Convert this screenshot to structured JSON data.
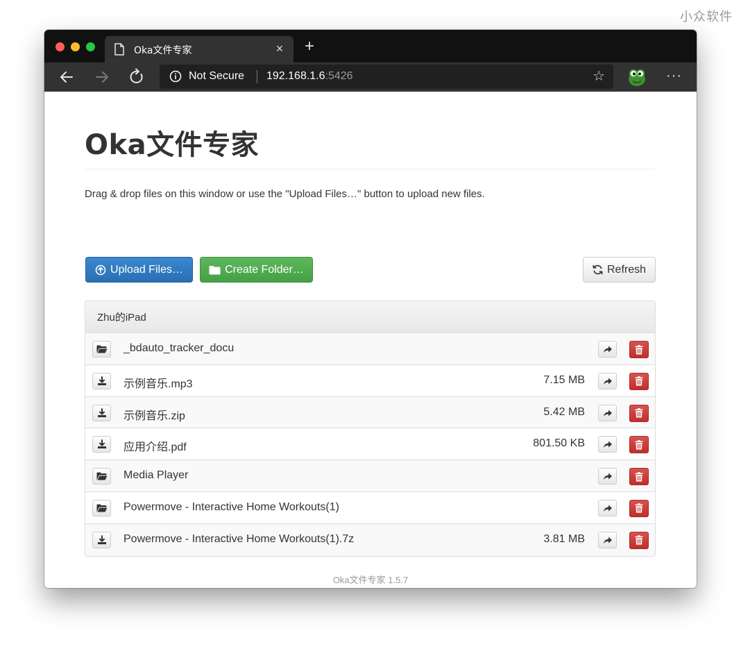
{
  "watermark": "小众软件",
  "browser": {
    "tab_title": "Oka文件专家",
    "close_glyph": "×",
    "new_tab_glyph": "+",
    "security_label": "Not Secure",
    "url_host": "192.168.1.6",
    "url_port": ":5426",
    "star_glyph": "☆",
    "more_glyph": "···",
    "icons": [
      "back-arrow-icon",
      "forward-arrow-icon",
      "reload-icon",
      "info-icon",
      "bookmark-star-icon",
      "extension-icon",
      "more-icon"
    ]
  },
  "page": {
    "title": "Oka文件专家",
    "instructions": "Drag & drop files on this window or use the \"Upload Files…\" button to upload new files.",
    "buttons": {
      "upload": "Upload Files…",
      "create_folder": "Create Folder…",
      "refresh": "Refresh"
    },
    "panel_title": "Zhu的iPad",
    "files": [
      {
        "type": "folder",
        "name": "_bdauto_tracker_docu",
        "size": ""
      },
      {
        "type": "file",
        "name": "示例音乐.mp3",
        "size": "7.15 MB"
      },
      {
        "type": "file",
        "name": "示例音乐.zip",
        "size": "5.42 MB"
      },
      {
        "type": "file",
        "name": "应用介绍.pdf",
        "size": "801.50 KB"
      },
      {
        "type": "folder",
        "name": "Media Player",
        "size": ""
      },
      {
        "type": "folder",
        "name": "Powermove - Interactive Home Workouts(1)",
        "size": ""
      },
      {
        "type": "file",
        "name": "Powermove - Interactive Home Workouts(1).7z",
        "size": "3.81 MB"
      }
    ],
    "footer": "Oka文件专家 1.5.7"
  },
  "colors": {
    "primary": "#337ab7",
    "success": "#5cb85c",
    "danger": "#d9534f"
  }
}
